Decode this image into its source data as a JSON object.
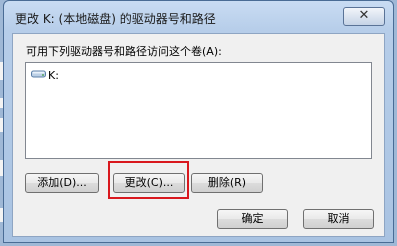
{
  "dialog": {
    "title": "更改 K: (本地磁盘) 的驱动器号和路径",
    "close_symbol": "✕",
    "caption": "可用下列驱动器号和路径访问这个卷(A):",
    "list_items": [
      {
        "label": "K:",
        "icon": "drive-icon"
      }
    ],
    "buttons": {
      "add": "添加(D)...",
      "change": "更改(C)...",
      "delete": "删除(R)",
      "ok": "确定",
      "cancel": "取消"
    }
  },
  "colors": {
    "highlight": "#d9181e",
    "titlebar": "#b6cde9"
  }
}
